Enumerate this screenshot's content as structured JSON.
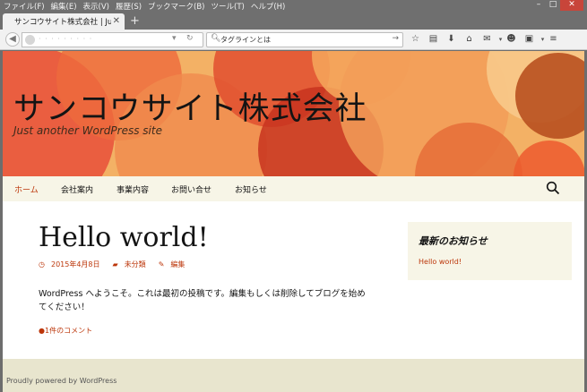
{
  "menu": [
    "ファイル(F)",
    "編集(E)",
    "表示(V)",
    "履歴(S)",
    "ブックマーク(B)",
    "ツール(T)",
    "ヘルプ(H)"
  ],
  "window_controls": {
    "minimize": "–",
    "maximize": "□",
    "close": "✕"
  },
  "tab": {
    "title": "サンコウサイト株式会社 | Just a...",
    "close": "✕",
    "new_tab": "+"
  },
  "toolbar": {
    "search_placeholder": "タグラインとは",
    "search_value": "タグラインとは",
    "icons": [
      "star-icon",
      "reading-list-icon",
      "download-icon",
      "home-icon",
      "pocket-icon",
      "chat-icon",
      "screenshot-icon",
      "menu-icon"
    ]
  },
  "site": {
    "title": "サンコウサイト株式会社",
    "description": "Just another WordPress site"
  },
  "nav": {
    "items": [
      "ホーム",
      "会社案内",
      "事業内容",
      "お問い合せ",
      "お知らせ"
    ],
    "active_index": 0
  },
  "post": {
    "title": "Hello world!",
    "date": "2015年4月8日",
    "category": "未分類",
    "edit": "編集",
    "content": "WordPress へようこそ。これは最初の投稿です。編集もしくは削除してブログを始めてください！",
    "comments": "1件のコメント"
  },
  "widget": {
    "title": "最新のお知らせ",
    "link": "Hello world!"
  },
  "footer": {
    "text": "Proudly powered by WordPress"
  },
  "colors": {
    "accent": "#bc360a",
    "header_bg": "#f3b165",
    "nav_bg": "#f7f5e7",
    "footer_bg": "#e8e5ce"
  }
}
